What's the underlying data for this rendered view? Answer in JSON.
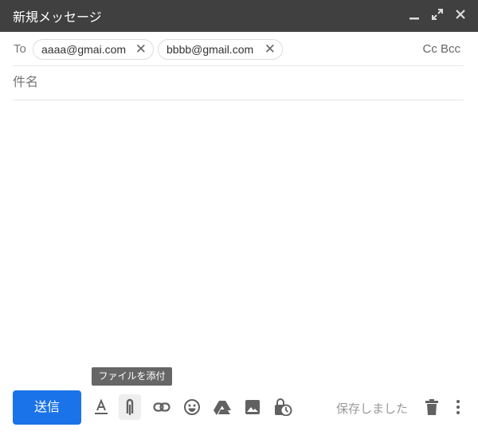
{
  "header": {
    "title": "新規メッセージ",
    "minimize": "_",
    "expand": "⤢",
    "close": "✕"
  },
  "to": {
    "label": "To",
    "recipients": [
      "aaaa@gmai.com",
      "bbbb@gmail.com"
    ],
    "remove": "✕",
    "cc_bcc": "Cc Bcc"
  },
  "subject": {
    "placeholder": "件名"
  },
  "toolbar": {
    "send": "送信",
    "tooltip": "ファイルを添付",
    "saved": "保存しました",
    "more": "⋮"
  },
  "colors": {
    "header": "#404040",
    "send": "#1a73e8",
    "icon": "#616161"
  }
}
